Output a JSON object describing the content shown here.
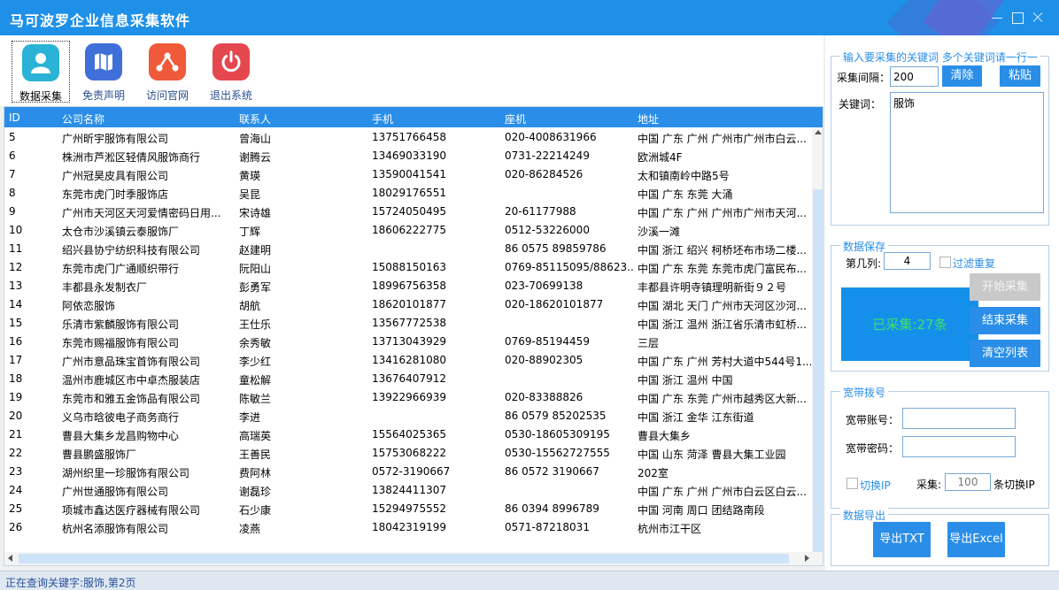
{
  "window": {
    "title": "马可波罗企业信息采集软件"
  },
  "toolbar": {
    "items": [
      {
        "label": "数据采集",
        "icon": "user-icon"
      },
      {
        "label": "免责声明",
        "icon": "map-icon"
      },
      {
        "label": "访问官网",
        "icon": "share-icon"
      },
      {
        "label": "退出系统",
        "icon": "power-icon"
      }
    ]
  },
  "table": {
    "columns": [
      "ID",
      "公司名称",
      "联系人",
      "手机",
      "座机",
      "地址"
    ],
    "rows": [
      [
        "5",
        "广州昕宇服饰有限公司",
        "曾海山",
        "13751766458",
        "020-4008631966",
        "中国 广东 广州  广州市广州市白云..."
      ],
      [
        "6",
        "株洲市芦淞区轻倩风服饰商行",
        "谢腾云",
        "13469033190",
        "0731-22214249",
        "欧洲城4F"
      ],
      [
        "7",
        "广州冠昊皮具有限公司",
        "黄瑛",
        "13590041541",
        "020-86284526",
        "太和镇南岭中路5号"
      ],
      [
        "8",
        "东莞市虎门时季服饰店",
        "吴昆",
        "18029176551",
        "",
        "中国 广东 东莞  大涌"
      ],
      [
        "9",
        "广州市天河区天河爱情密码日用...",
        "宋诗雄",
        "15724050495",
        "20-61177988",
        "中国 广东 广州  广州市广州市天河..."
      ],
      [
        "10",
        "太仓市沙溪镇云泰服饰厂",
        "丁辉",
        "18606222775",
        "0512-53226000",
        "沙溪一滩"
      ],
      [
        "11",
        "绍兴县协宁纺织科技有限公司",
        "赵建明",
        "",
        "86 0575 89859786",
        "中国 浙江 绍兴  柯桥坯布市场二楼..."
      ],
      [
        "12",
        "东莞市虎门广通顺织带行",
        "阮阳山",
        "15088150163",
        "0769-85115095/88623...",
        "中国 广东 东莞  东莞市虎门富民布..."
      ],
      [
        "13",
        "丰都县永发制衣厂",
        "彭勇军",
        "18996756358",
        "023-70699138",
        "丰都县许明寺镇理明新街９２号"
      ],
      [
        "14",
        "阿依恋服饰",
        "胡航",
        "18620101877",
        "020-18620101877",
        "中国 湖北 天门  广州市天河区沙河..."
      ],
      [
        "15",
        "乐清市紫麟服饰有限公司",
        "王仕乐",
        "13567772538",
        "",
        "中国 浙江 温州  浙江省乐清市虹桥..."
      ],
      [
        "16",
        "东莞市赐福服饰有限公司",
        "余秀敏",
        "13713043929",
        "0769-85194459",
        "三层"
      ],
      [
        "17",
        "广州市意品珠宝首饰有限公司",
        "李少红",
        "13416281080",
        "020-88902305",
        "中国 广东 广州  芳村大道中544号1..."
      ],
      [
        "18",
        "温州市鹿城区市中卓杰服装店",
        "童松解",
        "13676407912",
        "",
        "中国 浙江 温州  中国"
      ],
      [
        "19",
        "东莞市和雅五金饰品有限公司",
        "陈敏兰",
        "13922966939",
        "020-83388826",
        "中国 广东 东莞  广州市越秀区大新..."
      ],
      [
        "20",
        "义乌市晗彼电子商务商行",
        "李进",
        "",
        "86 0579 85202535",
        "中国 浙江 金华  江东街道"
      ],
      [
        "21",
        "曹县大集乡龙昌购物中心",
        "高瑞英",
        "15564025365",
        "0530-18605309195",
        "曹县大集乡"
      ],
      [
        "22",
        "曹县鹏盛服饰厂",
        "王善民",
        "15753068222",
        "0530-15562727555",
        "中国 山东 菏泽  曹县大集工业园"
      ],
      [
        "23",
        "湖州织里一珍服饰有限公司",
        "费阿林",
        "0572-3190667",
        "86 0572 3190667",
        "202室"
      ],
      [
        "24",
        "广州世通服饰有限公司",
        "谢磊珍",
        "13824411307",
        "",
        "中国 广东 广州  广州市白云区白云..."
      ],
      [
        "25",
        "项城市鑫达医疗器械有限公司",
        "石少康",
        "15294975552",
        "86 0394 8996789",
        "中国 河南 周口  团结路南段"
      ],
      [
        "26",
        "杭州名添服饰有限公司",
        "凌燕",
        "18042319199",
        "0571-87218031",
        "杭州市江干区"
      ]
    ]
  },
  "keyword_group": {
    "legend": "输入要采集的关键词 多个关键词请一行一",
    "interval_label": "采集间隔：",
    "interval_value": "200",
    "clear_label": "清除",
    "paste_label": "粘贴",
    "keyword_label": "关键词：",
    "keyword_value": "服饰"
  },
  "save_group": {
    "legend": "数据保存",
    "column_label": "第几列:",
    "column_value": "4",
    "filter_label": "过滤重复",
    "start_label": "开始采集",
    "stop_label": "结束采集",
    "clear_list_label": "清空列表",
    "counter_text": "已采集:27条"
  },
  "broadband_group": {
    "legend": "宽带拨号",
    "account_label": "宽带账号：",
    "password_label": "宽带密码：",
    "switch_ip_label": "切换IP",
    "collect_label": "采集:",
    "collect_value": "100",
    "switch_suffix": "条切换IP"
  },
  "export_group": {
    "legend": "数据导出",
    "txt_label": "导出TXT",
    "excel_label": "导出Excel"
  },
  "status": {
    "text": "正在查询关键字:服饰,第2页"
  },
  "colors": {
    "accent": "#2a8ee8",
    "titlebar": "#1e90e8",
    "counter_bg": "#1590ea",
    "counter_text": "#3ee06a"
  }
}
